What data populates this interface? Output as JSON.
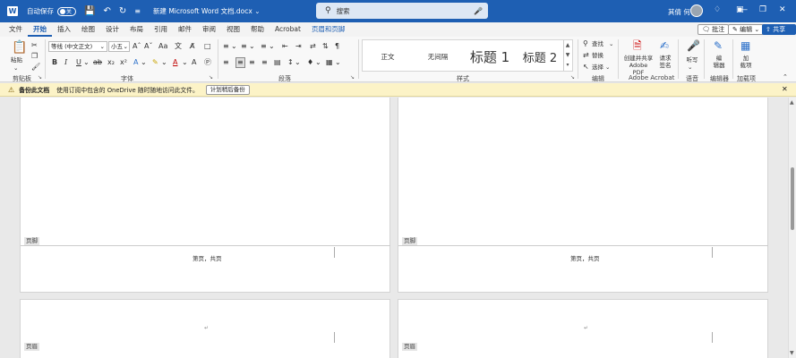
{
  "titlebar": {
    "autosave_label": "自动保存",
    "autosave_state": "关",
    "doc_title": "新建 Microsoft Word 文档.docx",
    "search_placeholder": "搜索",
    "user_name": "其倩 何"
  },
  "tabs": [
    "文件",
    "开始",
    "插入",
    "绘图",
    "设计",
    "布局",
    "引用",
    "邮件",
    "审阅",
    "视图",
    "帮助",
    "Acrobat",
    "页眉和页脚"
  ],
  "tab_actions": {
    "comment": "批注",
    "edit": "编辑",
    "share": "共享"
  },
  "ribbon": {
    "clipboard": {
      "paste": "粘贴",
      "label": "剪贴板"
    },
    "font": {
      "name": "等线 (中文正文)",
      "size": "小五",
      "label": "字体"
    },
    "paragraph": {
      "label": "段落"
    },
    "styles": {
      "label": "样式",
      "items": [
        "正文",
        "无间隔",
        "标题 1",
        "标题 2"
      ]
    },
    "editing": {
      "find": "查找",
      "replace": "替换",
      "select": "选择",
      "label": "编辑"
    },
    "acrobat": {
      "create_pdf_line1": "创建并共享",
      "create_pdf_line2": "Adobe PDF",
      "sign_line1": "请求",
      "sign_line2": "签名",
      "label": "Adobe Acrobat"
    },
    "voice": {
      "dictate": "听写",
      "label": "语音"
    },
    "editor": {
      "editor": "编辑器",
      "editor_line1": "编",
      "editor_line2": "辑器",
      "label": "编辑器"
    },
    "addins": {
      "addins_line1": "加",
      "addins_line2": "载项",
      "label": "加载项"
    }
  },
  "notification": {
    "title": "备份此文档",
    "message": "使用订阅中包含的 OneDrive 随时随地访问此文件。",
    "button": "计划稍后备份"
  },
  "document": {
    "footer_tag": "页脚",
    "header_tag": "页眉",
    "page_number_text": "第页，共页"
  }
}
